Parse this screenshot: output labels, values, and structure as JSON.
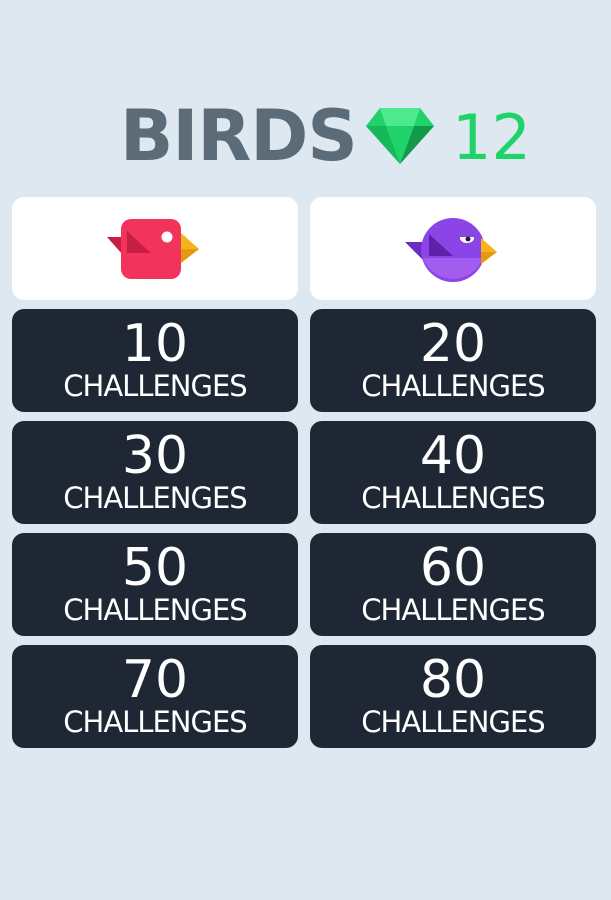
{
  "header": {
    "title": "BIRDS",
    "gem_count": "12",
    "gem_icon": "green-gem-icon",
    "gem_color": "#1fd36a"
  },
  "birds": [
    {
      "icon": "red-bird-icon",
      "color": "#f2335c"
    },
    {
      "icon": "purple-bird-icon",
      "color": "#8b45e6"
    }
  ],
  "challenges": [
    {
      "number": "10",
      "label": "CHALLENGES"
    },
    {
      "number": "20",
      "label": "CHALLENGES"
    },
    {
      "number": "30",
      "label": "CHALLENGES"
    },
    {
      "number": "40",
      "label": "CHALLENGES"
    },
    {
      "number": "50",
      "label": "CHALLENGES"
    },
    {
      "number": "60",
      "label": "CHALLENGES"
    },
    {
      "number": "70",
      "label": "CHALLENGES"
    },
    {
      "number": "80",
      "label": "CHALLENGES"
    }
  ],
  "colors": {
    "background": "#dde8f0",
    "title": "#5b6b78",
    "card_dark": "#1e2733",
    "card_light": "#ffffff"
  }
}
